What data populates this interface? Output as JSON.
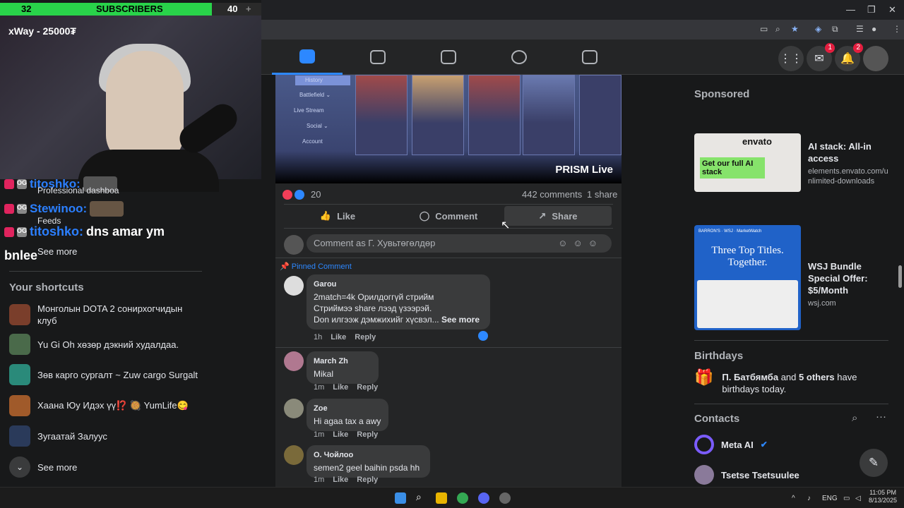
{
  "overlay": {
    "sub_left": "32",
    "sub_label": "SUBSCRIBERS",
    "sub_right": "40",
    "sub_plus": "+",
    "streamer_name": "xWay - 25000₮"
  },
  "chat": [
    {
      "name": "titoshko:",
      "text": "",
      "badge": "OG"
    },
    {
      "name": "Stewinoo:",
      "text": "",
      "badge": "OG"
    },
    {
      "name": "titoshko:",
      "text": "dns amar ym",
      "badge": "OG"
    }
  ],
  "chat_tail": "bnlee",
  "fb_left": {
    "professional": "Professional dashboa",
    "feeds": "Feeds",
    "see_more_top": "See more",
    "shortcuts_title": "Your shortcuts",
    "shortcuts": [
      "Монголын DOTA 2 сонирхогчидын клуб",
      "Yu Gi Oh хөзөр дэкний худалдаа.",
      "Зөв карго сургалт ~ Zuw cargo Surgalt",
      "Хаана Юу Идэх үү⁉️ 🥘 YumLife😋",
      "Зугаатай Залуус"
    ],
    "see_more": "See more"
  },
  "browser": {
    "minimize": "—",
    "restore": "❐",
    "close": "✕"
  },
  "fb_nav": {
    "messenger_badge": "1",
    "notif_badge": "2"
  },
  "video": {
    "menu": [
      "History",
      "Battlefield ⌄",
      "Live Stream",
      "Social ⌄",
      "Account"
    ],
    "watermark": "PRISM Live"
  },
  "post": {
    "reaction_count": "20",
    "comments": "442 comments",
    "shares": "1 share",
    "like_label": "Like",
    "comment_label": "Comment",
    "share_label": "Share",
    "comment_placeholder": "Comment as Г. Хувьтөгөлдөр",
    "pinned_label": "Pinned Comment"
  },
  "comments": [
    {
      "author": "Garou",
      "lines": [
        "2match=4k Орилдоггүй стрийм",
        "Стриймээ share лээд үзээрэй.",
        "Don илгээж дэмжихийг хүсвэл..."
      ],
      "see_more": "See more",
      "time": "1h",
      "like": "Like",
      "reply": "Reply"
    },
    {
      "author": "March Zh",
      "lines": [
        "Mikal"
      ],
      "time": "1m",
      "like": "Like",
      "reply": "Reply"
    },
    {
      "author": "Zoe",
      "lines": [
        "Hi agaa tax a awy"
      ],
      "time": "1m",
      "like": "Like",
      "reply": "Reply"
    },
    {
      "author": "О. Чойлоо",
      "lines": [
        "semen2 geel baihin psda hh"
      ],
      "time": "1m",
      "like": "Like",
      "reply": "Reply"
    }
  ],
  "rail": {
    "sponsored": "Sponsored",
    "ads": [
      {
        "title": "AI stack: All-in access",
        "url": "elements.envato.com/unlimited-downloads",
        "brand": "envato",
        "tagline": "Get our full AI stack"
      },
      {
        "title": "WSJ Bundle Special Offer: $5/Month",
        "url": "wsj.com",
        "brand": "BARRON'S · WSJ · MarketWatch",
        "tagline": "Three Top Titles. Together."
      }
    ],
    "birthdays_title": "Birthdays",
    "birthday_name": "П. Батбямба",
    "birthday_and": "and",
    "birthday_others": "5 others",
    "birthday_rest": "have birthdays today.",
    "contacts_title": "Contacts",
    "contacts": [
      "Meta AI",
      "Tsetse Tsetsuulee"
    ]
  },
  "taskbar": {
    "lang": "ENG",
    "time": "11:05 PM",
    "date": "8/13/2025"
  },
  "colors": {
    "accent": "#2d88ff",
    "sub_green": "#29d34a",
    "badge_red": "#e41e3f"
  }
}
